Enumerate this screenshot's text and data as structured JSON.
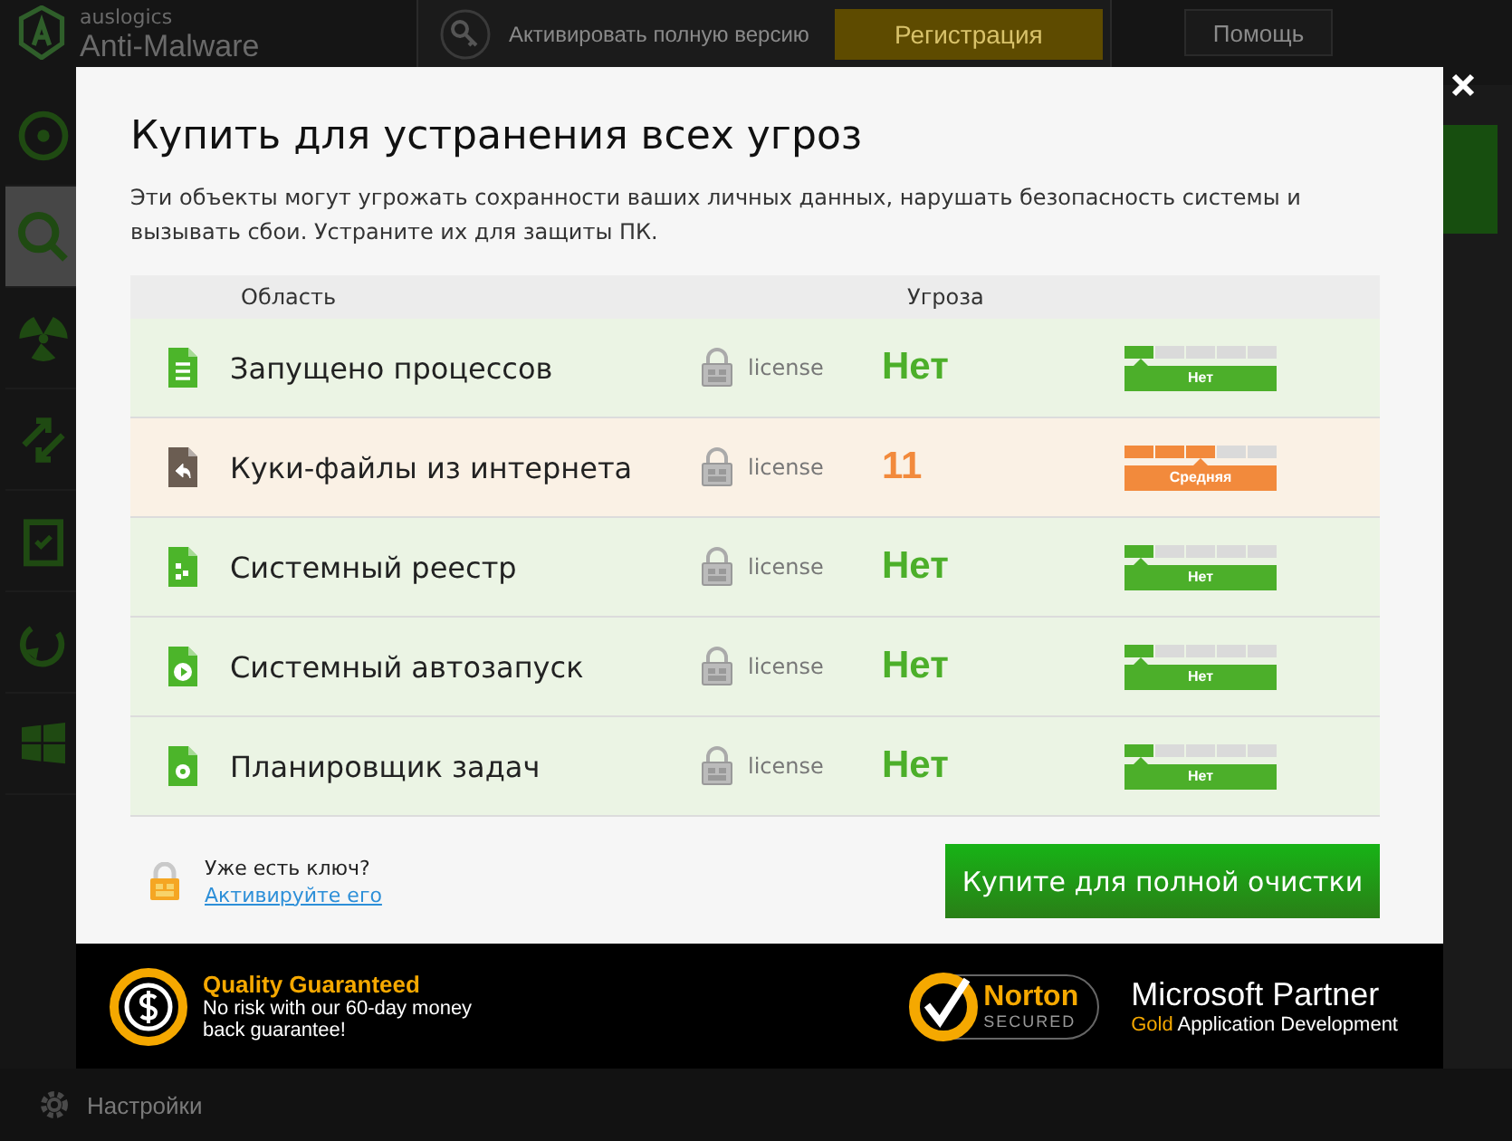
{
  "app": {
    "brand": "auslogics",
    "product": "Anti-Malware",
    "activate_text": "Активировать полную версию",
    "register_button": "Регистрация",
    "help_menu": "Помощь",
    "settings": "Настройки"
  },
  "dialog": {
    "title": "Купить для устранения всех угроз",
    "description": "Эти объекты могут угрожать сохранности ваших личных данных, нарушать безопасность системы и вызывать сбои. Устраните их для защиты ПК.",
    "columns": [
      "Область",
      "Угроза"
    ],
    "rows": [
      {
        "kind": "list",
        "name": "Запущено процессов",
        "lock_label": "license",
        "threat": "Нет",
        "color": "#4caf2a",
        "level": 0.2,
        "badge": "Нет"
      },
      {
        "kind": "back",
        "name": "Куки-файлы из интернета",
        "lock_label": "license",
        "threat": "11",
        "color": "#f28a3c",
        "level": 0.6,
        "badge": "Средняя"
      },
      {
        "kind": "grid",
        "name": "Системный реестр",
        "lock_label": "license",
        "threat": "Нет",
        "color": "#4caf2a",
        "level": 0.2,
        "badge": "Нет"
      },
      {
        "kind": "play",
        "name": "Системный автозапуск",
        "lock_label": "license",
        "threat": "Нет",
        "color": "#4caf2a",
        "level": 0.2,
        "badge": "Нет"
      },
      {
        "kind": "gear",
        "name": "Планировщик задач",
        "lock_label": "license",
        "threat": "Нет",
        "color": "#4caf2a",
        "level": 0.2,
        "badge": "Нет"
      }
    ],
    "key_question": "Уже есть ключ?",
    "activate_link": "Активируйте его",
    "buy_button": "Купите для полной очистки"
  },
  "footer": {
    "quality_title": "Quality Guaranteed",
    "quality_text": "No risk with our 60-day money back guarantee!",
    "norton_name": "Norton",
    "norton_sub": "SECURED",
    "ms_title": "Microsoft Partner",
    "ms_gold": "Gold",
    "ms_rest": "Application Development"
  }
}
